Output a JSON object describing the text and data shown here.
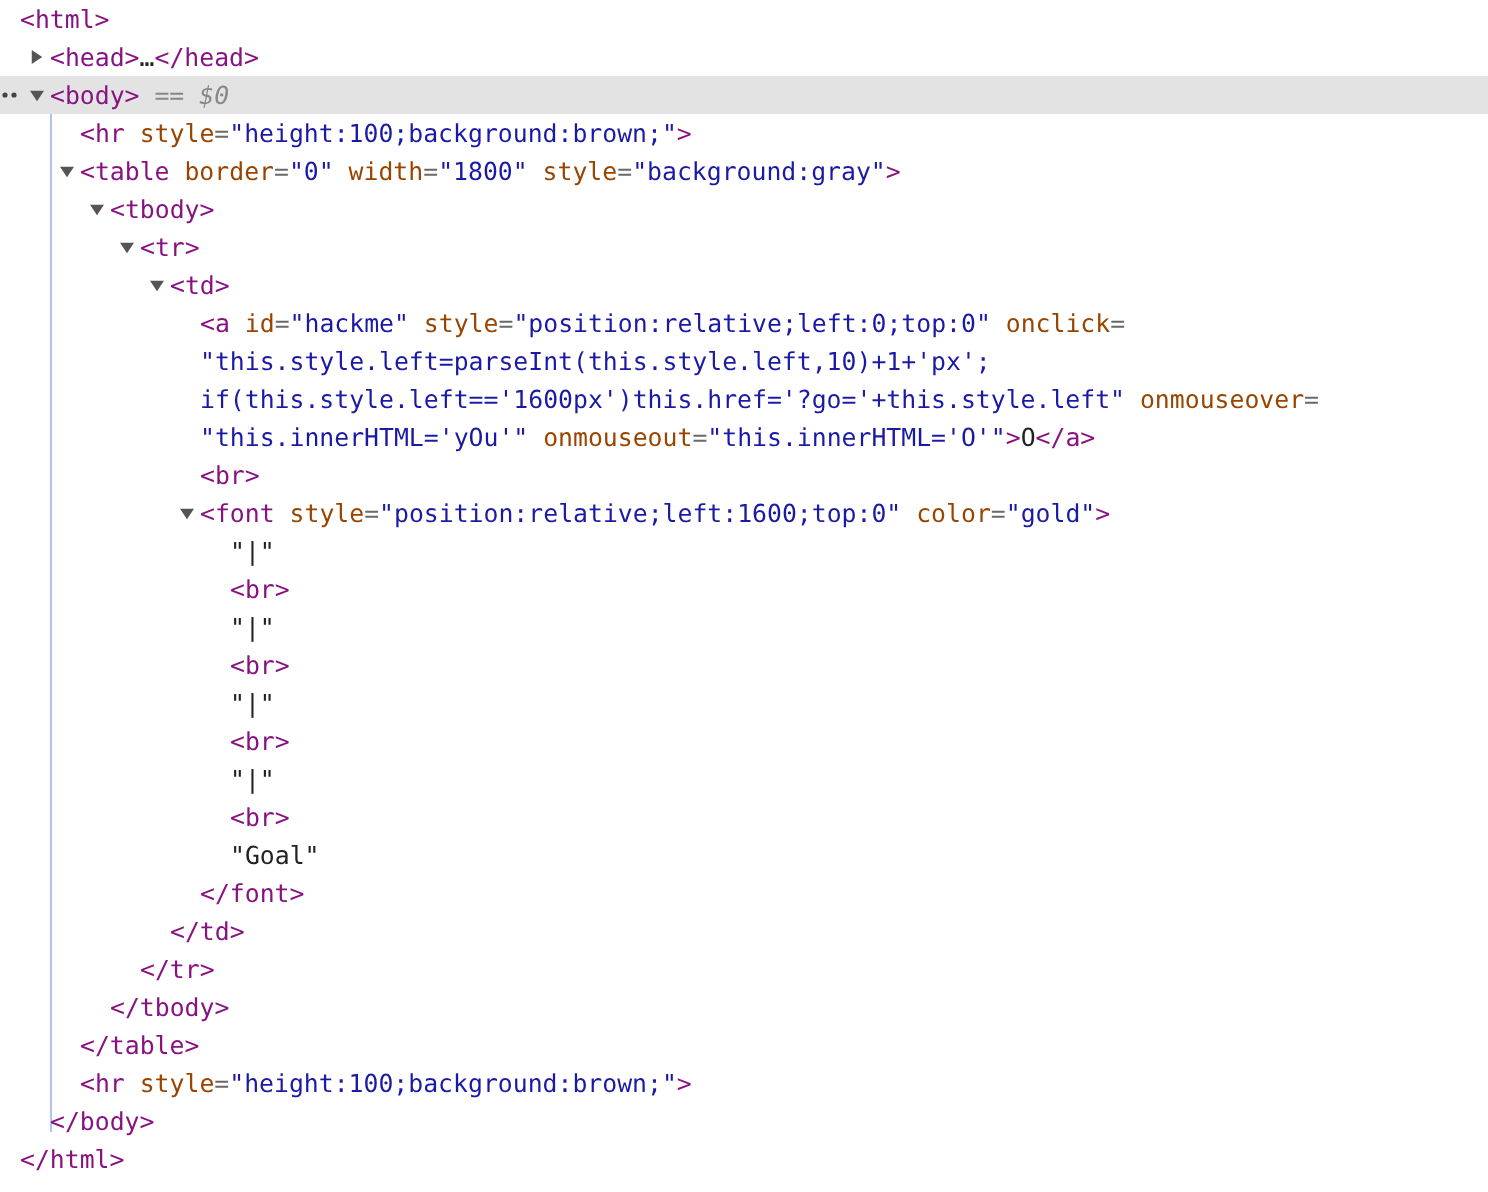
{
  "dom_tree": {
    "selected": false,
    "tokens": [
      {
        "kind": "tag",
        "text": "<html>"
      }
    ],
    "closing": [
      {
        "kind": "tag",
        "text": "</html>"
      }
    ],
    "children": [
      {
        "selected": false,
        "expanded": false,
        "tokens": [
          {
            "kind": "tag",
            "text": "<head>"
          },
          {
            "kind": "text",
            "text": "…"
          },
          {
            "kind": "tag",
            "text": "</head>"
          }
        ]
      },
      {
        "selected": true,
        "expanded": true,
        "tokens": [
          {
            "kind": "tag",
            "text": "<body>"
          },
          {
            "kind": "note",
            "text": " == "
          },
          {
            "kind": "var",
            "text": "$0"
          }
        ],
        "closing": [
          {
            "kind": "tag",
            "text": "</body>"
          }
        ],
        "children": [
          {
            "selected": false,
            "tokens": [
              {
                "kind": "tag",
                "text": "<hr"
              },
              {
                "kind": "attr",
                "text": " style"
              },
              {
                "kind": "punct",
                "text": "="
              },
              {
                "kind": "value",
                "text": "\"height:100;background:brown;\""
              },
              {
                "kind": "tag",
                "text": ">"
              }
            ]
          },
          {
            "selected": false,
            "expanded": true,
            "tokens": [
              {
                "kind": "tag",
                "text": "<table"
              },
              {
                "kind": "attr",
                "text": " border"
              },
              {
                "kind": "punct",
                "text": "="
              },
              {
                "kind": "value",
                "text": "\"0\""
              },
              {
                "kind": "attr",
                "text": " width"
              },
              {
                "kind": "punct",
                "text": "="
              },
              {
                "kind": "value",
                "text": "\"1800\""
              },
              {
                "kind": "attr",
                "text": " style"
              },
              {
                "kind": "punct",
                "text": "="
              },
              {
                "kind": "value",
                "text": "\"background:gray\""
              },
              {
                "kind": "tag",
                "text": ">"
              }
            ],
            "closing": [
              {
                "kind": "tag",
                "text": "</table>"
              }
            ],
            "children": [
              {
                "selected": false,
                "expanded": true,
                "tokens": [
                  {
                    "kind": "tag",
                    "text": "<tbody>"
                  }
                ],
                "closing": [
                  {
                    "kind": "tag",
                    "text": "</tbody>"
                  }
                ],
                "children": [
                  {
                    "selected": false,
                    "expanded": true,
                    "tokens": [
                      {
                        "kind": "tag",
                        "text": "<tr>"
                      }
                    ],
                    "closing": [
                      {
                        "kind": "tag",
                        "text": "</tr>"
                      }
                    ],
                    "children": [
                      {
                        "selected": false,
                        "expanded": true,
                        "tokens": [
                          {
                            "kind": "tag",
                            "text": "<td>"
                          }
                        ],
                        "closing": [
                          {
                            "kind": "tag",
                            "text": "</td>"
                          }
                        ],
                        "children": [
                          {
                            "selected": false,
                            "tokens": [
                              {
                                "kind": "tag",
                                "text": "<a"
                              },
                              {
                                "kind": "attr",
                                "text": " id"
                              },
                              {
                                "kind": "punct",
                                "text": "="
                              },
                              {
                                "kind": "value",
                                "text": "\"hackme\""
                              },
                              {
                                "kind": "attr",
                                "text": " style"
                              },
                              {
                                "kind": "punct",
                                "text": "="
                              },
                              {
                                "kind": "value",
                                "text": "\"position:relative;left:0;top:0\""
                              },
                              {
                                "kind": "attr",
                                "text": " onclick"
                              },
                              {
                                "kind": "punct",
                                "text": "="
                              },
                              {
                                "kind": "value",
                                "text": " \"this.style.left=parseInt(this.style.left,10)+1+'px'; if(this.style.left=='1600px')this.href='?go='+this.style.left\""
                              },
                              {
                                "kind": "attr",
                                "text": " onmouseover"
                              },
                              {
                                "kind": "punct",
                                "text": "="
                              },
                              {
                                "kind": "value",
                                "text": " \"this.innerHTML='yOu'\""
                              },
                              {
                                "kind": "attr",
                                "text": " onmouseout"
                              },
                              {
                                "kind": "punct",
                                "text": "="
                              },
                              {
                                "kind": "value",
                                "text": "\"this.innerHTML='O'\""
                              },
                              {
                                "kind": "tag",
                                "text": ">"
                              },
                              {
                                "kind": "text",
                                "text": "O"
                              },
                              {
                                "kind": "tag",
                                "text": "</a>"
                              }
                            ]
                          },
                          {
                            "selected": false,
                            "tokens": [
                              {
                                "kind": "tag",
                                "text": "<br>"
                              }
                            ]
                          },
                          {
                            "selected": false,
                            "expanded": true,
                            "tokens": [
                              {
                                "kind": "tag",
                                "text": "<font"
                              },
                              {
                                "kind": "attr",
                                "text": " style"
                              },
                              {
                                "kind": "punct",
                                "text": "="
                              },
                              {
                                "kind": "value",
                                "text": "\"position:relative;left:1600;top:0\""
                              },
                              {
                                "kind": "attr",
                                "text": " color"
                              },
                              {
                                "kind": "punct",
                                "text": "="
                              },
                              {
                                "kind": "value",
                                "text": "\"gold\""
                              },
                              {
                                "kind": "tag",
                                "text": ">"
                              }
                            ],
                            "closing": [
                              {
                                "kind": "tag",
                                "text": "</font>"
                              }
                            ],
                            "children": [
                              {
                                "selected": false,
                                "tokens": [
                                  {
                                    "kind": "text",
                                    "text": "\"|\""
                                  }
                                ]
                              },
                              {
                                "selected": false,
                                "tokens": [
                                  {
                                    "kind": "tag",
                                    "text": "<br>"
                                  }
                                ]
                              },
                              {
                                "selected": false,
                                "tokens": [
                                  {
                                    "kind": "text",
                                    "text": "\"|\""
                                  }
                                ]
                              },
                              {
                                "selected": false,
                                "tokens": [
                                  {
                                    "kind": "tag",
                                    "text": "<br>"
                                  }
                                ]
                              },
                              {
                                "selected": false,
                                "tokens": [
                                  {
                                    "kind": "text",
                                    "text": "\"|\""
                                  }
                                ]
                              },
                              {
                                "selected": false,
                                "tokens": [
                                  {
                                    "kind": "tag",
                                    "text": "<br>"
                                  }
                                ]
                              },
                              {
                                "selected": false,
                                "tokens": [
                                  {
                                    "kind": "text",
                                    "text": "\"|\""
                                  }
                                ]
                              },
                              {
                                "selected": false,
                                "tokens": [
                                  {
                                    "kind": "tag",
                                    "text": "<br>"
                                  }
                                ]
                              },
                              {
                                "selected": false,
                                "tokens": [
                                  {
                                    "kind": "text",
                                    "text": "\"Goal\""
                                  }
                                ]
                              }
                            ]
                          }
                        ]
                      }
                    ]
                  }
                ]
              }
            ]
          },
          {
            "selected": false,
            "tokens": [
              {
                "kind": "tag",
                "text": "<hr"
              },
              {
                "kind": "attr",
                "text": " style"
              },
              {
                "kind": "punct",
                "text": "="
              },
              {
                "kind": "value",
                "text": "\"height:100;background:brown;\""
              },
              {
                "kind": "tag",
                "text": ">"
              }
            ]
          }
        ]
      }
    ]
  }
}
